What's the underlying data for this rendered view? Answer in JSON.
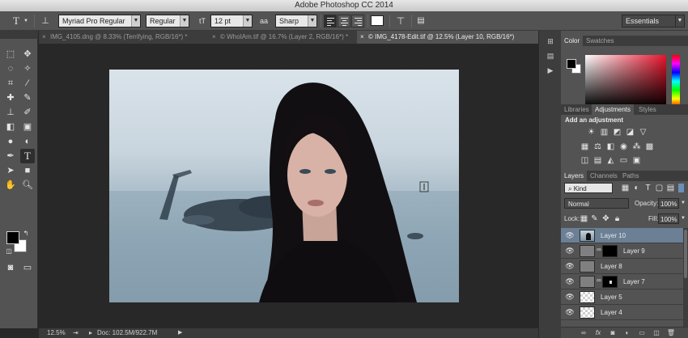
{
  "title_bar": {
    "title": "Adobe Photoshop CC 2014"
  },
  "options_bar": {
    "tool_icon": "type-tool-icon",
    "font_family": "Myriad Pro Regular",
    "font_style": "Regular",
    "font_size": "12 pt",
    "antialias_icon": "aa",
    "antialias": "Sharp",
    "text_color": "#ffffff",
    "workspace": "Essentials"
  },
  "document_tabs": [
    {
      "label": "IMG_4105.dng @ 8.33% (Terrifying, RGB/16*) *",
      "active": false
    },
    {
      "label": "© WhoIAm.tif @ 16.7% (Layer 2, RGB/16*) *",
      "active": false
    },
    {
      "label": "© IMG_4178-Edit.tif @ 12.5% (Layer 10, RGB/16*)",
      "active": true
    }
  ],
  "status_bar": {
    "zoom": "12.5%",
    "doc_info": "Doc: 102.5M/922.7M"
  },
  "colors": {
    "foreground": "#000000",
    "background": "#ffffff",
    "selected_layer": "#6b7f95"
  },
  "color_panel": {
    "tabs": [
      "Color",
      "Swatches"
    ],
    "active": "Color"
  },
  "adjustments_panel": {
    "tabs": [
      "Libraries",
      "Adjustments",
      "Styles"
    ],
    "active": "Adjustments",
    "heading": "Add an adjustment"
  },
  "layers_panel": {
    "tabs": [
      "Layers",
      "Channels",
      "Paths"
    ],
    "active": "Layers",
    "filter": "Kind",
    "blend_mode": "Normal",
    "opacity_label": "Opacity:",
    "opacity": "100%",
    "lock_label": "Lock:",
    "fill_label": "Fill:",
    "fill": "100%",
    "layers": [
      {
        "name": "Layer 10",
        "selected": true,
        "thumb": "photo",
        "mask": false
      },
      {
        "name": "Layer 9",
        "selected": false,
        "thumb": "gray",
        "mask": true
      },
      {
        "name": "Layer 8",
        "selected": false,
        "thumb": "gray",
        "mask": false
      },
      {
        "name": "Layer 7",
        "selected": false,
        "thumb": "gray",
        "mask": true
      },
      {
        "name": "Layer 5",
        "selected": false,
        "thumb": "checker",
        "mask": false
      },
      {
        "name": "Layer 4",
        "selected": false,
        "thumb": "checker",
        "mask": false
      }
    ]
  }
}
